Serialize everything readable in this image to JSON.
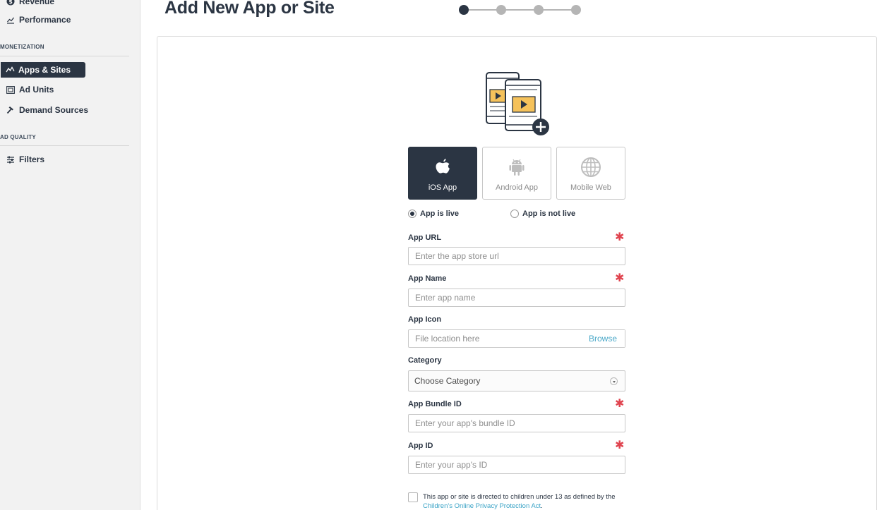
{
  "sidebar": {
    "top_items": [
      {
        "label": "Revenue",
        "icon": "dollar-circle-icon"
      },
      {
        "label": "Performance",
        "icon": "trend-chart-icon"
      }
    ],
    "sections": [
      {
        "label": "MONETIZATION",
        "items": [
          {
            "label": "Apps & Sites",
            "icon": "apps-sites-icon",
            "active": true
          },
          {
            "label": "Ad Units",
            "icon": "ad-units-icon",
            "active": false
          },
          {
            "label": "Demand Sources",
            "icon": "hammer-icon",
            "active": false
          }
        ]
      },
      {
        "label": "AD QUALITY",
        "items": [
          {
            "label": "Filters",
            "icon": "sliders-icon",
            "active": false
          }
        ]
      }
    ]
  },
  "header": {
    "title": "Add New App or Site",
    "stepper": {
      "total_steps": 4,
      "current_step": 1
    }
  },
  "platforms": [
    {
      "label": "iOS App",
      "icon": "apple-icon",
      "selected": true
    },
    {
      "label": "Android App",
      "icon": "android-icon",
      "selected": false
    },
    {
      "label": "Mobile Web",
      "icon": "globe-icon",
      "selected": false
    }
  ],
  "app_status": {
    "options": [
      {
        "label": "App is live",
        "checked": true
      },
      {
        "label": "App is not live",
        "checked": false
      }
    ]
  },
  "form": {
    "app_url": {
      "label": "App URL",
      "placeholder": "Enter the app store url",
      "value": "",
      "required": true
    },
    "app_name": {
      "label": "App Name",
      "placeholder": "Enter app name",
      "value": "",
      "required": true
    },
    "app_icon": {
      "label": "App Icon",
      "placeholder": "File location here",
      "browse_label": "Browse"
    },
    "category": {
      "label": "Category",
      "selected": "Choose Category"
    },
    "bundle_id": {
      "label": "App Bundle ID",
      "placeholder": "Enter your app's bundle ID",
      "value": "",
      "required": true
    },
    "app_id": {
      "label": "App ID",
      "placeholder": "Enter your app's ID",
      "value": "",
      "required": true
    },
    "required_mark": "✱"
  },
  "coppa": {
    "checked": false,
    "text_before": "This app or site is directed to children under 13 as defined by the ",
    "link_text": "Children's Online Privacy Protection Act",
    "text_after": "."
  },
  "colors": {
    "primary": "#2b3543",
    "required": "#e0444f",
    "link": "#3aa3c6",
    "illustration_accent": "#f5c25b"
  }
}
